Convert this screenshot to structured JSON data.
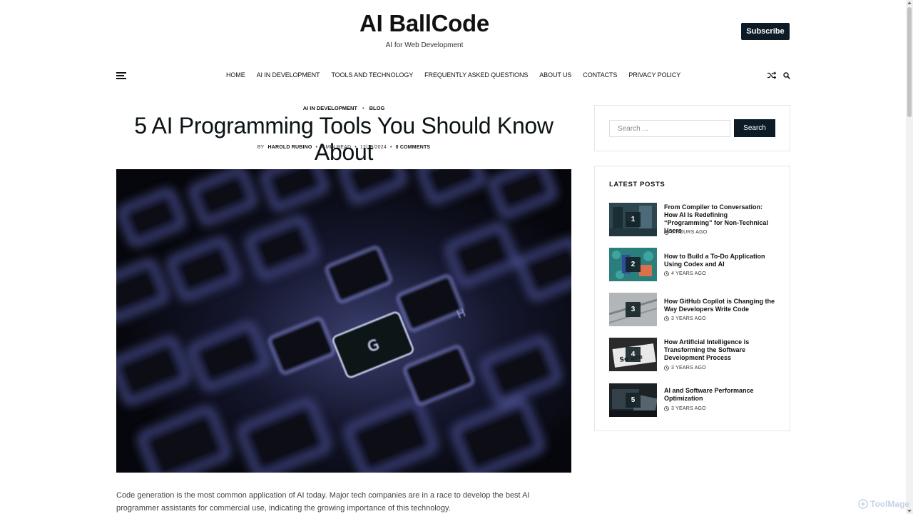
{
  "site": {
    "title": "AI BallCode",
    "tagline": "AI for Web Development",
    "subscribe_label": "Subscribe"
  },
  "nav": {
    "items": [
      "HOME",
      "AI IN DEVELOPMENT",
      "TOOLS AND TECHNOLOGY",
      "FREQUENTLY ASKED QUESTIONS",
      "ABOUT US",
      "CONTACTS",
      "PRIVACY POLICY"
    ],
    "icons": [
      "menu-icon",
      "shuffle-icon",
      "search-icon"
    ]
  },
  "article": {
    "categories": [
      "AI IN DEVELOPMENT",
      "BLOG"
    ],
    "title": "5 AI Programming Tools You Should Know About",
    "meta": {
      "by": "BY",
      "author": "HAROLD RUBINO",
      "read_time": "4 MIN READ",
      "date": "12/19/2024",
      "comments": "0 COMMENTS"
    },
    "excerpt": "Code generation is the most common application of AI today. Major tech companies are in a race to develop the best AI programmer assistants for commercial use, indicating the growing importance of this technology."
  },
  "sidebar": {
    "search": {
      "placeholder": "Search ...",
      "button_label": "Search"
    },
    "latest": {
      "heading": "LATEST POSTS",
      "posts": [
        {
          "num": "1",
          "title": "From Compiler to Conversation: How AI Is Redefining “Programming” for Non-Technical Users",
          "time": "8 HOURS AGO"
        },
        {
          "num": "2",
          "title": "How to Build a To-Do Application Using Codex and AI",
          "time": "4 YEARS AGO"
        },
        {
          "num": "3",
          "title": "How GitHub Copilot is Changing the Way Developers Write Code",
          "time": "3 YEARS AGO"
        },
        {
          "num": "4",
          "title": "How Artificial Intelligence is Transforming the Software Development Process",
          "time": "3 YEARS AGO"
        },
        {
          "num": "5",
          "title": "AI and Software Performance Optimization",
          "time": "3 YEARS AGO"
        }
      ]
    }
  },
  "watermark": "ToolMage",
  "colors": {
    "accent": "#0d1b26",
    "text": "#111111"
  }
}
